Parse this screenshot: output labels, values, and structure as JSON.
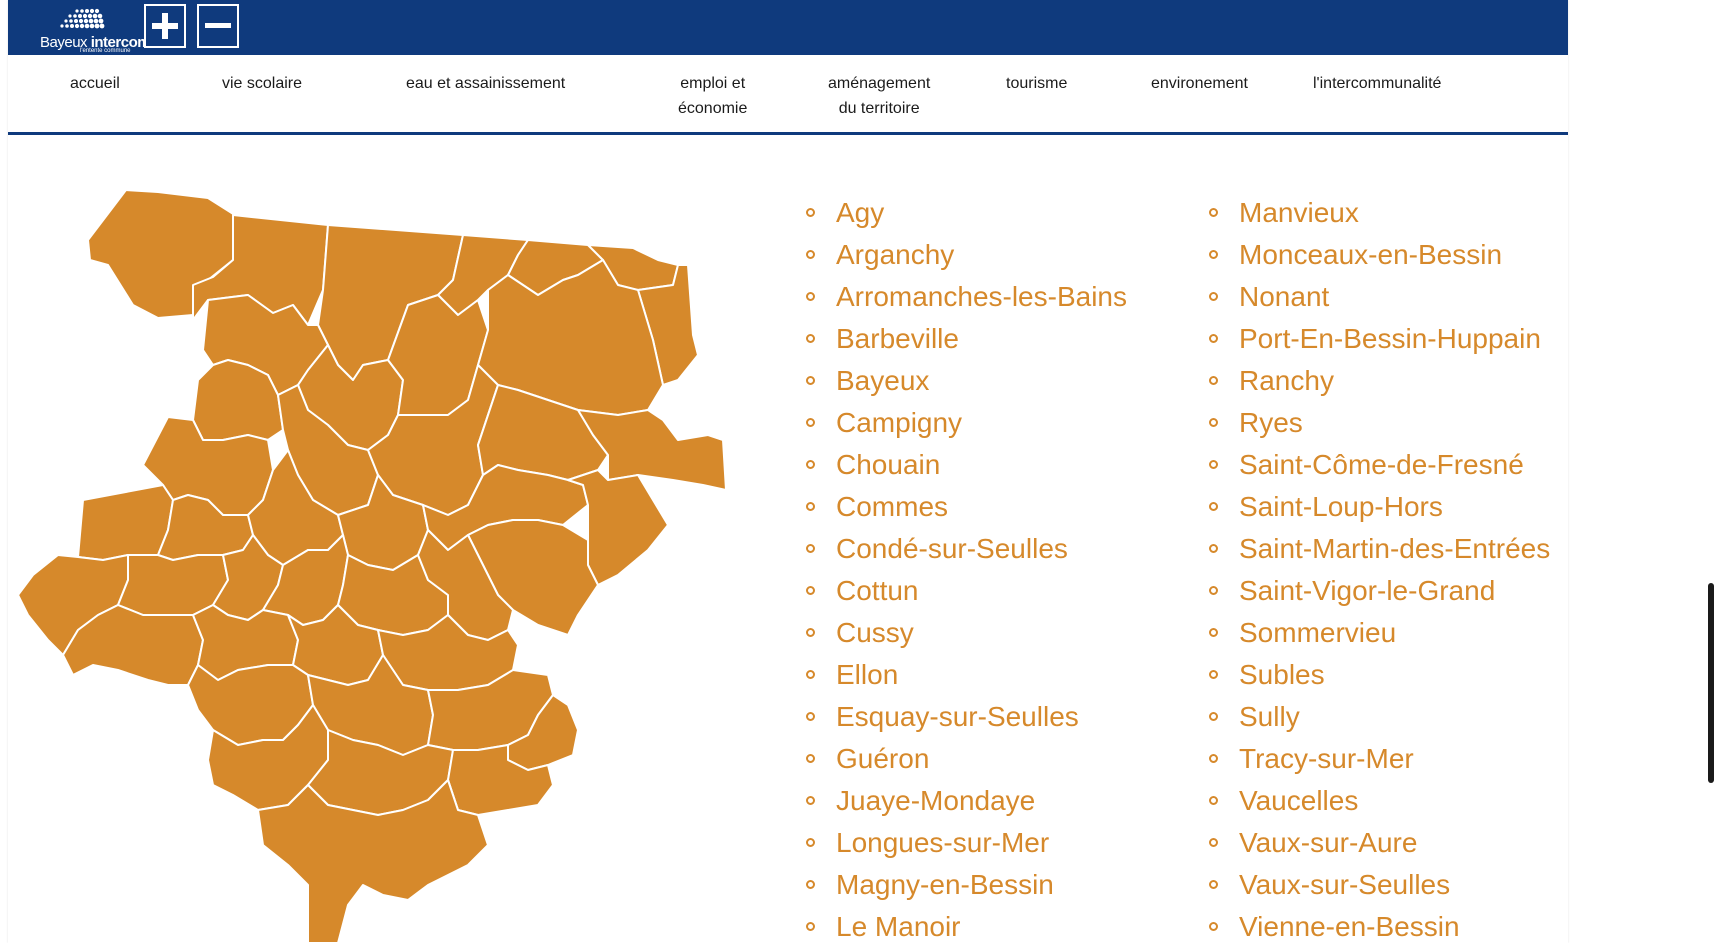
{
  "header": {
    "logo_alt": "Bayeux intercom",
    "logo_text_light": "Bayeux",
    "logo_text_bold": "intercom",
    "logo_tagline": "l'entente commune",
    "zoom_in_icon": "plus-icon",
    "zoom_out_icon": "minus-icon",
    "bar_color": "#0f3a7d"
  },
  "nav": {
    "items": [
      {
        "line1": "accueil",
        "line2": ""
      },
      {
        "line1": "vie scolaire",
        "line2": ""
      },
      {
        "line1": "eau et assainissement",
        "line2": ""
      },
      {
        "line1": "emploi et",
        "line2": "économie"
      },
      {
        "line1": "aménagement",
        "line2": "du territoire"
      },
      {
        "line1": "tourisme",
        "line2": ""
      },
      {
        "line1": "environement",
        "line2": ""
      },
      {
        "line1": "l'intercommunalité",
        "line2": ""
      }
    ]
  },
  "map": {
    "fill_color": "#d6892b",
    "border_color": "#ffffff"
  },
  "communes": {
    "color": "#d6892b",
    "column1": [
      "Agy",
      "Arganchy",
      "Arromanches-les-Bains",
      "Barbeville",
      "Bayeux",
      "Campigny",
      "Chouain",
      "Commes",
      "Condé-sur-Seulles",
      "Cottun",
      "Cussy",
      "Ellon",
      "Esquay-sur-Seulles",
      "Guéron",
      "Juaye-Mondaye",
      "Longues-sur-Mer",
      "Magny-en-Bessin",
      "Le Manoir"
    ],
    "column2": [
      "Manvieux",
      "Monceaux-en-Bessin",
      "Nonant",
      "Port-En-Bessin-Huppain",
      "Ranchy",
      "Ryes",
      "Saint-Côme-de-Fresné",
      "Saint-Loup-Hors",
      "Saint-Martin-des-Entrées",
      "Saint-Vigor-le-Grand",
      "Sommervieu",
      "Subles",
      "Sully",
      "Tracy-sur-Mer",
      "Vaucelles",
      "Vaux-sur-Aure",
      "Vaux-sur-Seulles",
      "Vienne-en-Bessin"
    ]
  }
}
